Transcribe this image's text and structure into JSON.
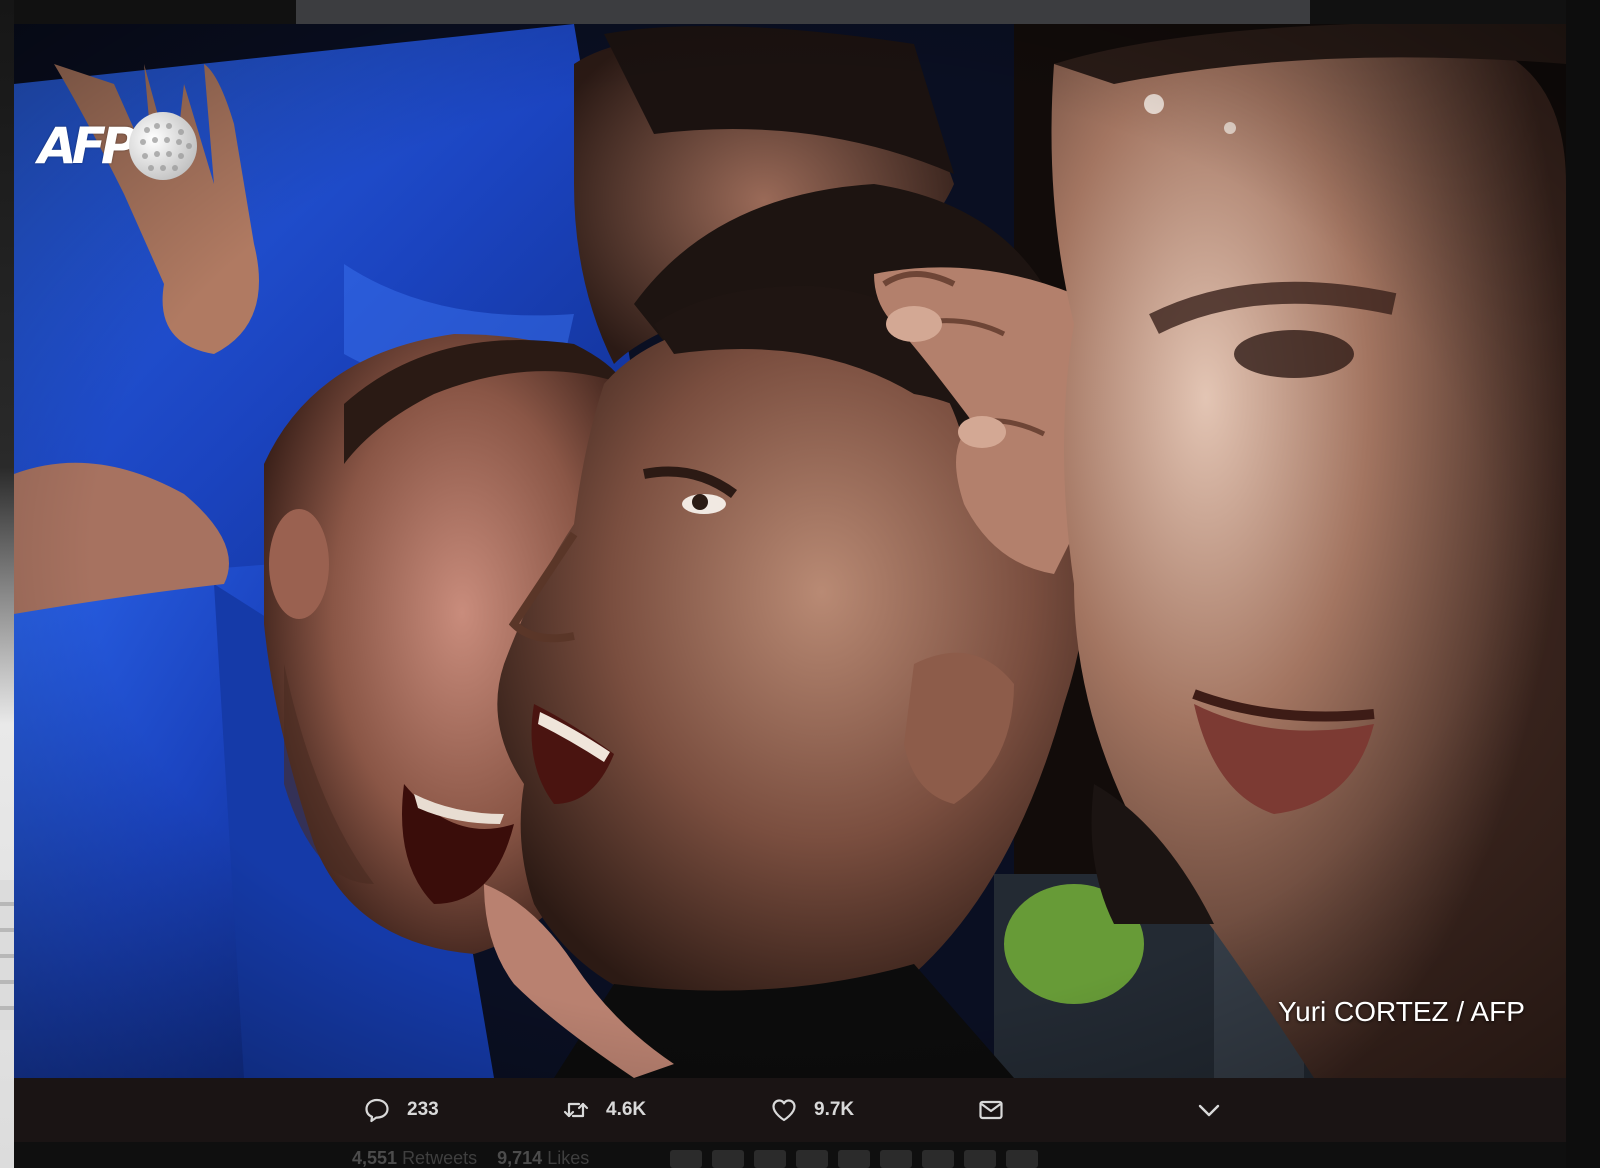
{
  "photo": {
    "watermark": "AFP",
    "credit": "Yuri CORTEZ / AFP"
  },
  "actions": {
    "reply_count": "233",
    "retweet_count": "4.6K",
    "like_count": "9.7K"
  },
  "icons": {
    "reply": "speech-bubble-icon",
    "retweet": "retweet-arrows-icon",
    "like": "heart-icon",
    "direct_message": "envelope-icon",
    "more": "chevron-down-icon"
  },
  "background_tweet": {
    "retweets_count": "4,551",
    "retweets_label": "Retweets",
    "likes_count": "9,714",
    "likes_label": "Likes"
  },
  "colors": {
    "action_bar_bg": "#1a1414",
    "action_text": "#d9d9d9",
    "jersey_blue": "#1f4fd6"
  }
}
